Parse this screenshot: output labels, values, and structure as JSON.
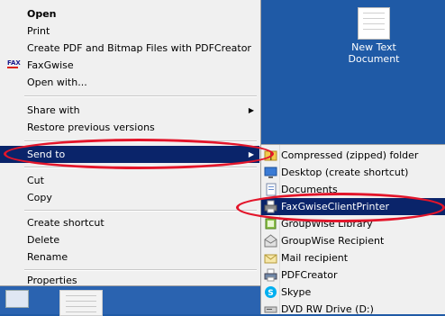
{
  "context_menu": {
    "items": [
      {
        "label": "Open"
      },
      {
        "label": "Print"
      },
      {
        "label": "Create PDF and Bitmap Files with PDFCreator"
      },
      {
        "label": "FaxGwise"
      },
      {
        "label": "Open with..."
      },
      {
        "label": "Share with"
      },
      {
        "label": "Restore previous versions"
      },
      {
        "label": "Send to"
      },
      {
        "label": "Cut"
      },
      {
        "label": "Copy"
      },
      {
        "label": "Create shortcut"
      },
      {
        "label": "Delete"
      },
      {
        "label": "Rename"
      },
      {
        "label": "Properties"
      }
    ],
    "fax_icon_text": "FAX"
  },
  "send_to_menu": {
    "items": [
      {
        "label": "Compressed (zipped) folder",
        "icon": "zip-folder-icon"
      },
      {
        "label": "Desktop (create shortcut)",
        "icon": "desktop-icon"
      },
      {
        "label": "Documents",
        "icon": "documents-icon"
      },
      {
        "label": "FaxGwiseClientPrinter",
        "icon": "printer-icon"
      },
      {
        "label": "GroupWise Library",
        "icon": "library-icon"
      },
      {
        "label": "GroupWise Recipient",
        "icon": "recipient-icon"
      },
      {
        "label": "Mail recipient",
        "icon": "mail-icon"
      },
      {
        "label": "PDFCreator",
        "icon": "printer-icon"
      },
      {
        "label": "Skype",
        "icon": "skype-icon"
      },
      {
        "label": "DVD RW Drive (D:)",
        "icon": "dvd-drive-icon"
      }
    ]
  },
  "desktop": {
    "new_text_document_label": "New Text Document"
  },
  "colors": {
    "highlight": "#0a246a",
    "desktop": "#1f5aa6",
    "annotation": "#e3152a"
  }
}
